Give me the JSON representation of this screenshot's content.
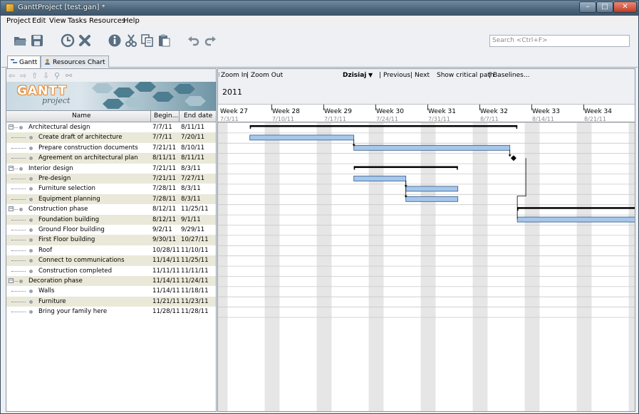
{
  "window": {
    "title": "GanttProject [test.gan] *",
    "min_label": "–",
    "max_label": "□",
    "close_label": "✕"
  },
  "menu": [
    "Project",
    "Edit",
    "View",
    "Tasks",
    "Resources",
    "Help"
  ],
  "toolbar": {
    "search_placeholder": "Search <Ctrl+F>"
  },
  "tabs": [
    {
      "label": "Gantt",
      "active": true
    },
    {
      "label": "Resources Chart",
      "active": false
    }
  ],
  "logo": {
    "word": "GANTT",
    "sub": "project"
  },
  "columns": {
    "name": "Name",
    "begin": "Begin...",
    "end": "End date"
  },
  "tasks": [
    {
      "name": "Architectural design",
      "begin": "7/7/11",
      "end": "8/11/11",
      "level": 0
    },
    {
      "name": "Create draft of architecture",
      "begin": "7/7/11",
      "end": "7/20/11",
      "level": 1
    },
    {
      "name": "Prepare construction documents",
      "begin": "7/21/11",
      "end": "8/10/11",
      "level": 1
    },
    {
      "name": "Agreement on architectural plan",
      "begin": "8/11/11",
      "end": "8/11/11",
      "level": 1
    },
    {
      "name": "Interior design",
      "begin": "7/21/11",
      "end": "8/3/11",
      "level": 0
    },
    {
      "name": "Pre-design",
      "begin": "7/21/11",
      "end": "7/27/11",
      "level": 1
    },
    {
      "name": "Furniture selection",
      "begin": "7/28/11",
      "end": "8/3/11",
      "level": 1
    },
    {
      "name": "Equipment planning",
      "begin": "7/28/11",
      "end": "8/3/11",
      "level": 1
    },
    {
      "name": "Construction phase",
      "begin": "8/12/11",
      "end": "11/25/11",
      "level": 0
    },
    {
      "name": "Foundation building",
      "begin": "8/12/11",
      "end": "9/1/11",
      "level": 1
    },
    {
      "name": "Ground Floor building",
      "begin": "9/2/11",
      "end": "9/29/11",
      "level": 1
    },
    {
      "name": "First Floor building",
      "begin": "9/30/11",
      "end": "10/27/11",
      "level": 1
    },
    {
      "name": "Roof",
      "begin": "10/28/11",
      "end": "11/10/11",
      "level": 1
    },
    {
      "name": "Connect to communications",
      "begin": "11/14/11",
      "end": "11/25/11",
      "level": 1
    },
    {
      "name": "Construction completed",
      "begin": "11/11/11",
      "end": "11/11/11",
      "level": 1
    },
    {
      "name": "Decoration phase",
      "begin": "11/14/11",
      "end": "11/24/11",
      "level": 0
    },
    {
      "name": "Walls",
      "begin": "11/14/11",
      "end": "11/18/11",
      "level": 1
    },
    {
      "name": "Furniture",
      "begin": "11/21/11",
      "end": "11/23/11",
      "level": 1
    },
    {
      "name": "Bring your family here",
      "begin": "11/28/11",
      "end": "11/28/11",
      "level": 1
    }
  ],
  "chart_toolbar": {
    "zoom_in": "Zoom In",
    "sep1": "|",
    "zoom_out": "Zoom Out",
    "today": "Dzisiaj",
    "previous": "Previous",
    "sep2": "|",
    "next": "Next",
    "critical": "Show critical path",
    "sep3": "|",
    "baselines": "Baselines..."
  },
  "timeline": {
    "year": "2011",
    "weeks": [
      {
        "label": "Week 27",
        "date": "7/3/11"
      },
      {
        "label": "Week 28",
        "date": "7/10/11"
      },
      {
        "label": "Week 29",
        "date": "7/17/11"
      },
      {
        "label": "Week 30",
        "date": "7/24/11"
      },
      {
        "label": "Week 31",
        "date": "7/31/11"
      },
      {
        "label": "Week 32",
        "date": "8/7/11"
      },
      {
        "label": "Week 33",
        "date": "8/14/11"
      },
      {
        "label": "Week 34",
        "date": "8/21/11"
      }
    ]
  },
  "colors": {
    "bar_fill": "#a7c7ea",
    "bar_border": "#2d5a87",
    "summary": "#000000",
    "weekend": "#e6e6e6",
    "alt_row": "#eae9d9"
  }
}
